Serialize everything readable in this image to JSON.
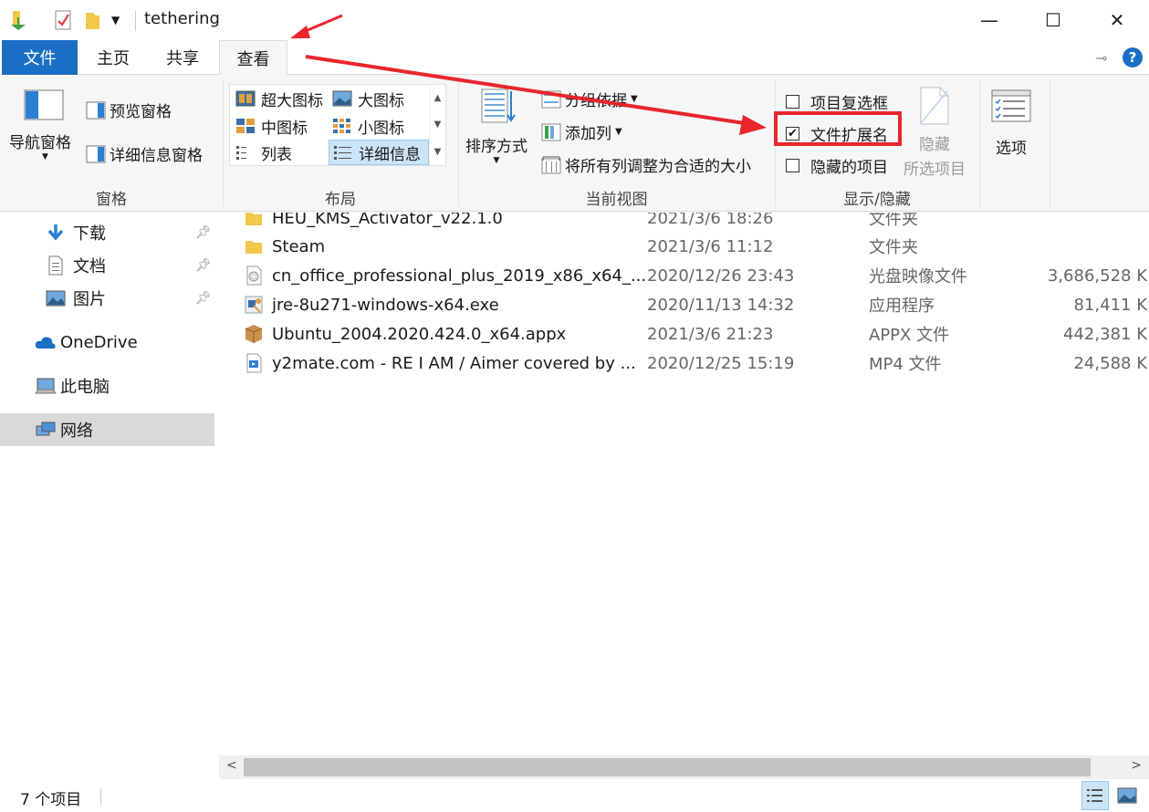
{
  "window": {
    "title": "tethering",
    "controls": {
      "minimize": "—",
      "maximize": "☐",
      "close": "✕"
    }
  },
  "tabs": [
    {
      "label": "文件"
    },
    {
      "label": "主页"
    },
    {
      "label": "共享"
    },
    {
      "label": "查看"
    }
  ],
  "ribbon": {
    "panes": {
      "label": "窗格",
      "nav_pane": "导航窗格",
      "preview_pane": "预览窗格",
      "details_pane": "详细信息窗格"
    },
    "layout": {
      "label": "布局",
      "items": [
        "超大图标",
        "大图标",
        "中图标",
        "小图标",
        "列表",
        "详细信息"
      ],
      "selected": "详细信息"
    },
    "current_view": {
      "label": "当前视图",
      "sort_by": "排序方式",
      "group_by": "分组依据",
      "add_columns": "添加列",
      "fit_columns": "将所有列调整为合适的大小"
    },
    "show_hide": {
      "label": "显示/隐藏",
      "item_checkboxes": "项目复选框",
      "item_checkboxes_checked": false,
      "file_extensions": "文件扩展名",
      "file_extensions_checked": true,
      "hidden_items": "隐藏的项目",
      "hidden_items_checked": false,
      "hide_selected_1": "隐藏",
      "hide_selected_2": "所选项目"
    },
    "options": {
      "label": "选项"
    }
  },
  "nav": {
    "items": [
      {
        "label": "下载",
        "icon": "download-icon",
        "pinned": true
      },
      {
        "label": "文档",
        "icon": "document-icon",
        "pinned": true
      },
      {
        "label": "图片",
        "icon": "pictures-icon",
        "pinned": true
      },
      {
        "label": "OneDrive",
        "icon": "cloud-icon"
      },
      {
        "label": "此电脑",
        "icon": "computer-icon"
      },
      {
        "label": "网络",
        "icon": "network-icon",
        "selected": true
      }
    ]
  },
  "files": [
    {
      "name": "HEU_KMS_Activator_v22.1.0",
      "date": "2021/3/6 18:26",
      "type": "文件夹",
      "size": "",
      "icon": "folder-icon"
    },
    {
      "name": "Steam",
      "date": "2021/3/6 11:12",
      "type": "文件夹",
      "size": "",
      "icon": "folder-icon"
    },
    {
      "name": "cn_office_professional_plus_2019_x86_x64_...",
      "date": "2020/12/26 23:43",
      "type": "光盘映像文件",
      "size": "3,686,528 K",
      "icon": "disc-image-icon"
    },
    {
      "name": "jre-8u271-windows-x64.exe",
      "date": "2020/11/13 14:32",
      "type": "应用程序",
      "size": "81,411 K",
      "icon": "installer-icon"
    },
    {
      "name": "Ubuntu_2004.2020.424.0_x64.appx",
      "date": "2021/3/6 21:23",
      "type": "APPX 文件",
      "size": "442,381 K",
      "icon": "package-icon"
    },
    {
      "name": "y2mate.com - RE I AM / Aimer covered by ...",
      "date": "2020/12/25 15:19",
      "type": "MP4 文件",
      "size": "24,588 K",
      "icon": "video-icon"
    }
  ],
  "status": {
    "count": "7 个项目"
  },
  "colors": {
    "accent": "#1a6fc4",
    "annotation": "#e8262c",
    "selection": "#cce4f7"
  }
}
